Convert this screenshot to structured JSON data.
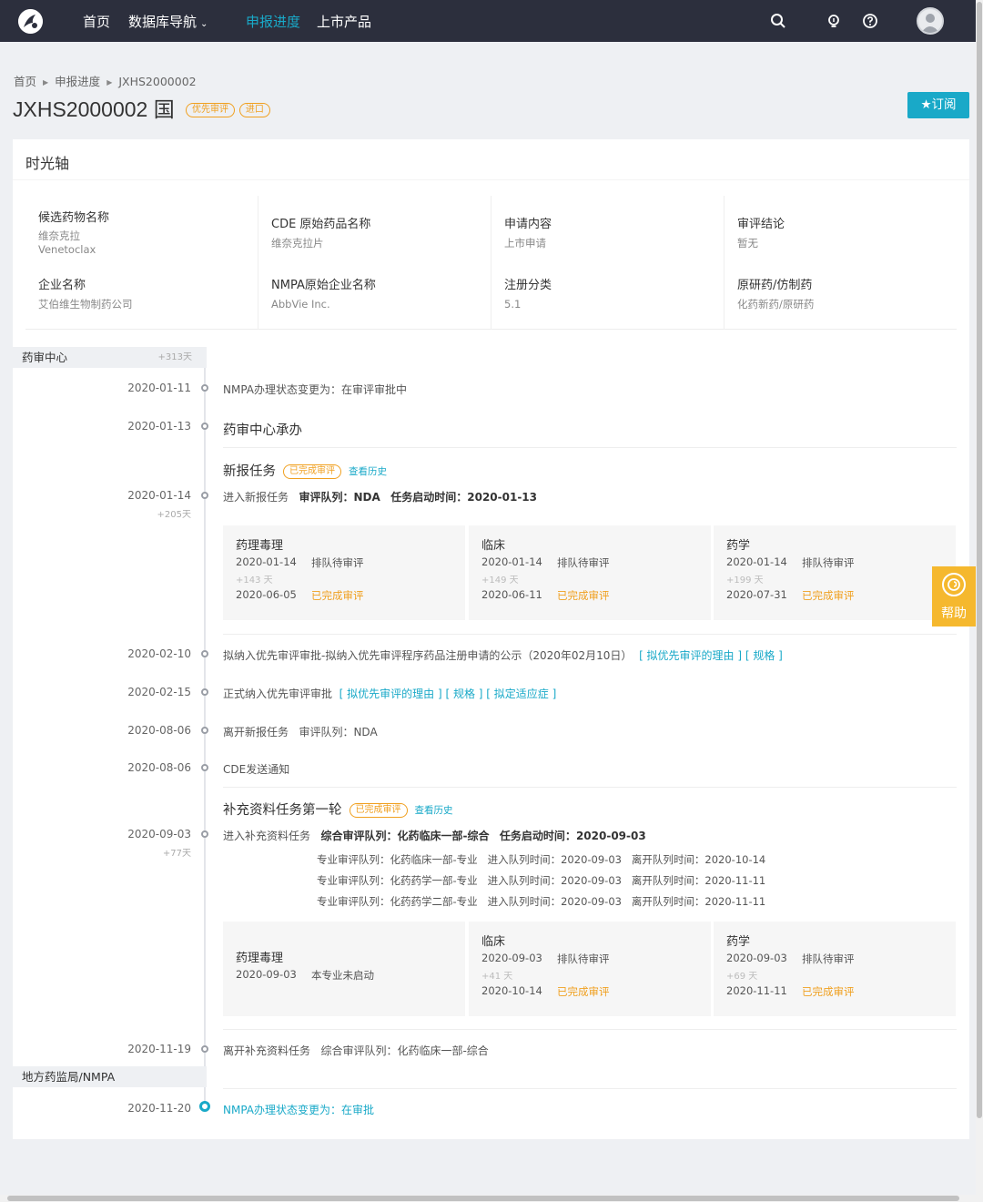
{
  "nav": {
    "items": [
      "首页",
      "数据库导航",
      "申报进度",
      "上市产品"
    ],
    "active_index": 2,
    "icons": [
      "search-icon",
      "lightbulb-icon",
      "question-icon",
      "user-avatar"
    ]
  },
  "breadcrumb": [
    "首页",
    "申报进度",
    "JXHS2000002"
  ],
  "title": {
    "code": "JXHS2000002 国",
    "tags": [
      "优先审评",
      "进口"
    ],
    "subscribe": "★订阅"
  },
  "card": {
    "title": "时光轴",
    "info": [
      [
        {
          "label": "候选药物名称",
          "value": "维奈克拉\nVenetoclax"
        },
        {
          "label": "企业名称",
          "value": "艾伯维生物制药公司"
        }
      ],
      [
        {
          "label": "CDE 原始药品名称",
          "value": "维奈克拉片"
        },
        {
          "label": "NMPA原始企业名称",
          "value": "AbbVie Inc."
        }
      ],
      [
        {
          "label": "申请内容",
          "value": "上市申请"
        },
        {
          "label": "注册分类",
          "value": "5.1"
        }
      ],
      [
        {
          "label": "审评结论",
          "value": "暂无"
        },
        {
          "label": "原研药/仿制药",
          "value": "化药新药/原研药"
        }
      ]
    ]
  },
  "timeline": {
    "section1": {
      "label": "药审中心",
      "delta": "+313天"
    },
    "section2": {
      "label": "地方药监局/NMPA"
    },
    "events": {
      "e1": {
        "date": "2020-01-11",
        "text": "NMPA办理状态变更为：在审评审批中"
      },
      "e2": {
        "date": "2020-01-13",
        "text": "药审中心承办"
      },
      "task1": {
        "title": "新报任务",
        "tag": "已完成审评",
        "history": "查看历史"
      },
      "e3": {
        "date": "2020-01-14",
        "delta": "+205天",
        "prefix": "进入新报任务",
        "queue_label": "审评队列：",
        "queue": "NDA",
        "start_label": "任务启动时间：",
        "start": "2020-01-13"
      },
      "e4": {
        "date": "2020-02-10",
        "text": "拟纳入优先审评审批-拟纳入优先审评程序药品注册申请的公示（2020年02月10日）",
        "links": "[ 拟优先审评的理由 ] [ 规格 ]"
      },
      "e5": {
        "date": "2020-02-15",
        "text": "正式纳入优先审评审批",
        "links": "[ 拟优先审评的理由 ] [ 规格 ] [ 拟定适应症 ]"
      },
      "e6": {
        "date": "2020-08-06",
        "text": "离开新报任务   审评队列：NDA"
      },
      "e7": {
        "date": "2020-08-06",
        "text": "CDE发送通知"
      },
      "task2": {
        "title": "补充资料任务第一轮",
        "tag": "已完成审评",
        "history": "查看历史"
      },
      "e8": {
        "date": "2020-09-03",
        "delta": "+77天",
        "prefix": "进入补充资料任务",
        "queue_label": "综合审评队列：",
        "queue": "化药临床一部-综合",
        "start_label": "任务启动时间：",
        "start": "2020-09-03"
      },
      "queues": [
        "专业审评队列：化药临床一部-专业   进入队列时间：2020-09-03   离开队列时间：2020-10-14",
        "专业审评队列：化药药学一部-专业   进入队列时间：2020-09-03   离开队列时间：2020-11-11",
        "专业审评队列：化药药学二部-专业   进入队列时间：2020-09-03   离开队列时间：2020-11-11"
      ],
      "e9": {
        "date": "2020-11-19",
        "text": "离开补充资料任务   综合审评队列：化药临床一部-综合"
      },
      "e10": {
        "date": "2020-11-20",
        "text": "NMPA办理状态变更为：在审批"
      }
    },
    "boxes1": [
      {
        "title": "药理毒理",
        "d1": "2020-01-14",
        "s1": "排队待审评",
        "days": "+143 天",
        "d2": "2020-06-05",
        "s2": "已完成审评"
      },
      {
        "title": "临床",
        "d1": "2020-01-14",
        "s1": "排队待审评",
        "days": "+149 天",
        "d2": "2020-06-11",
        "s2": "已完成审评"
      },
      {
        "title": "药学",
        "d1": "2020-01-14",
        "s1": "排队待审评",
        "days": "+199 天",
        "d2": "2020-07-31",
        "s2": "已完成审评"
      }
    ],
    "boxes2": [
      {
        "title": "药理毒理",
        "d1": "2020-09-03",
        "s1": "本专业未启动"
      },
      {
        "title": "临床",
        "d1": "2020-09-03",
        "s1": "排队待审评",
        "days": "+41 天",
        "d2": "2020-10-14",
        "s2": "已完成审评"
      },
      {
        "title": "药学",
        "d1": "2020-09-03",
        "s1": "排队待审评",
        "days": "+69 天",
        "d2": "2020-11-11",
        "s2": "已完成审评"
      }
    ]
  },
  "help": {
    "label": "帮助"
  },
  "colors": {
    "accent": "#19a9c8",
    "warning": "#f0a020",
    "topbar": "#2c2f3d"
  }
}
